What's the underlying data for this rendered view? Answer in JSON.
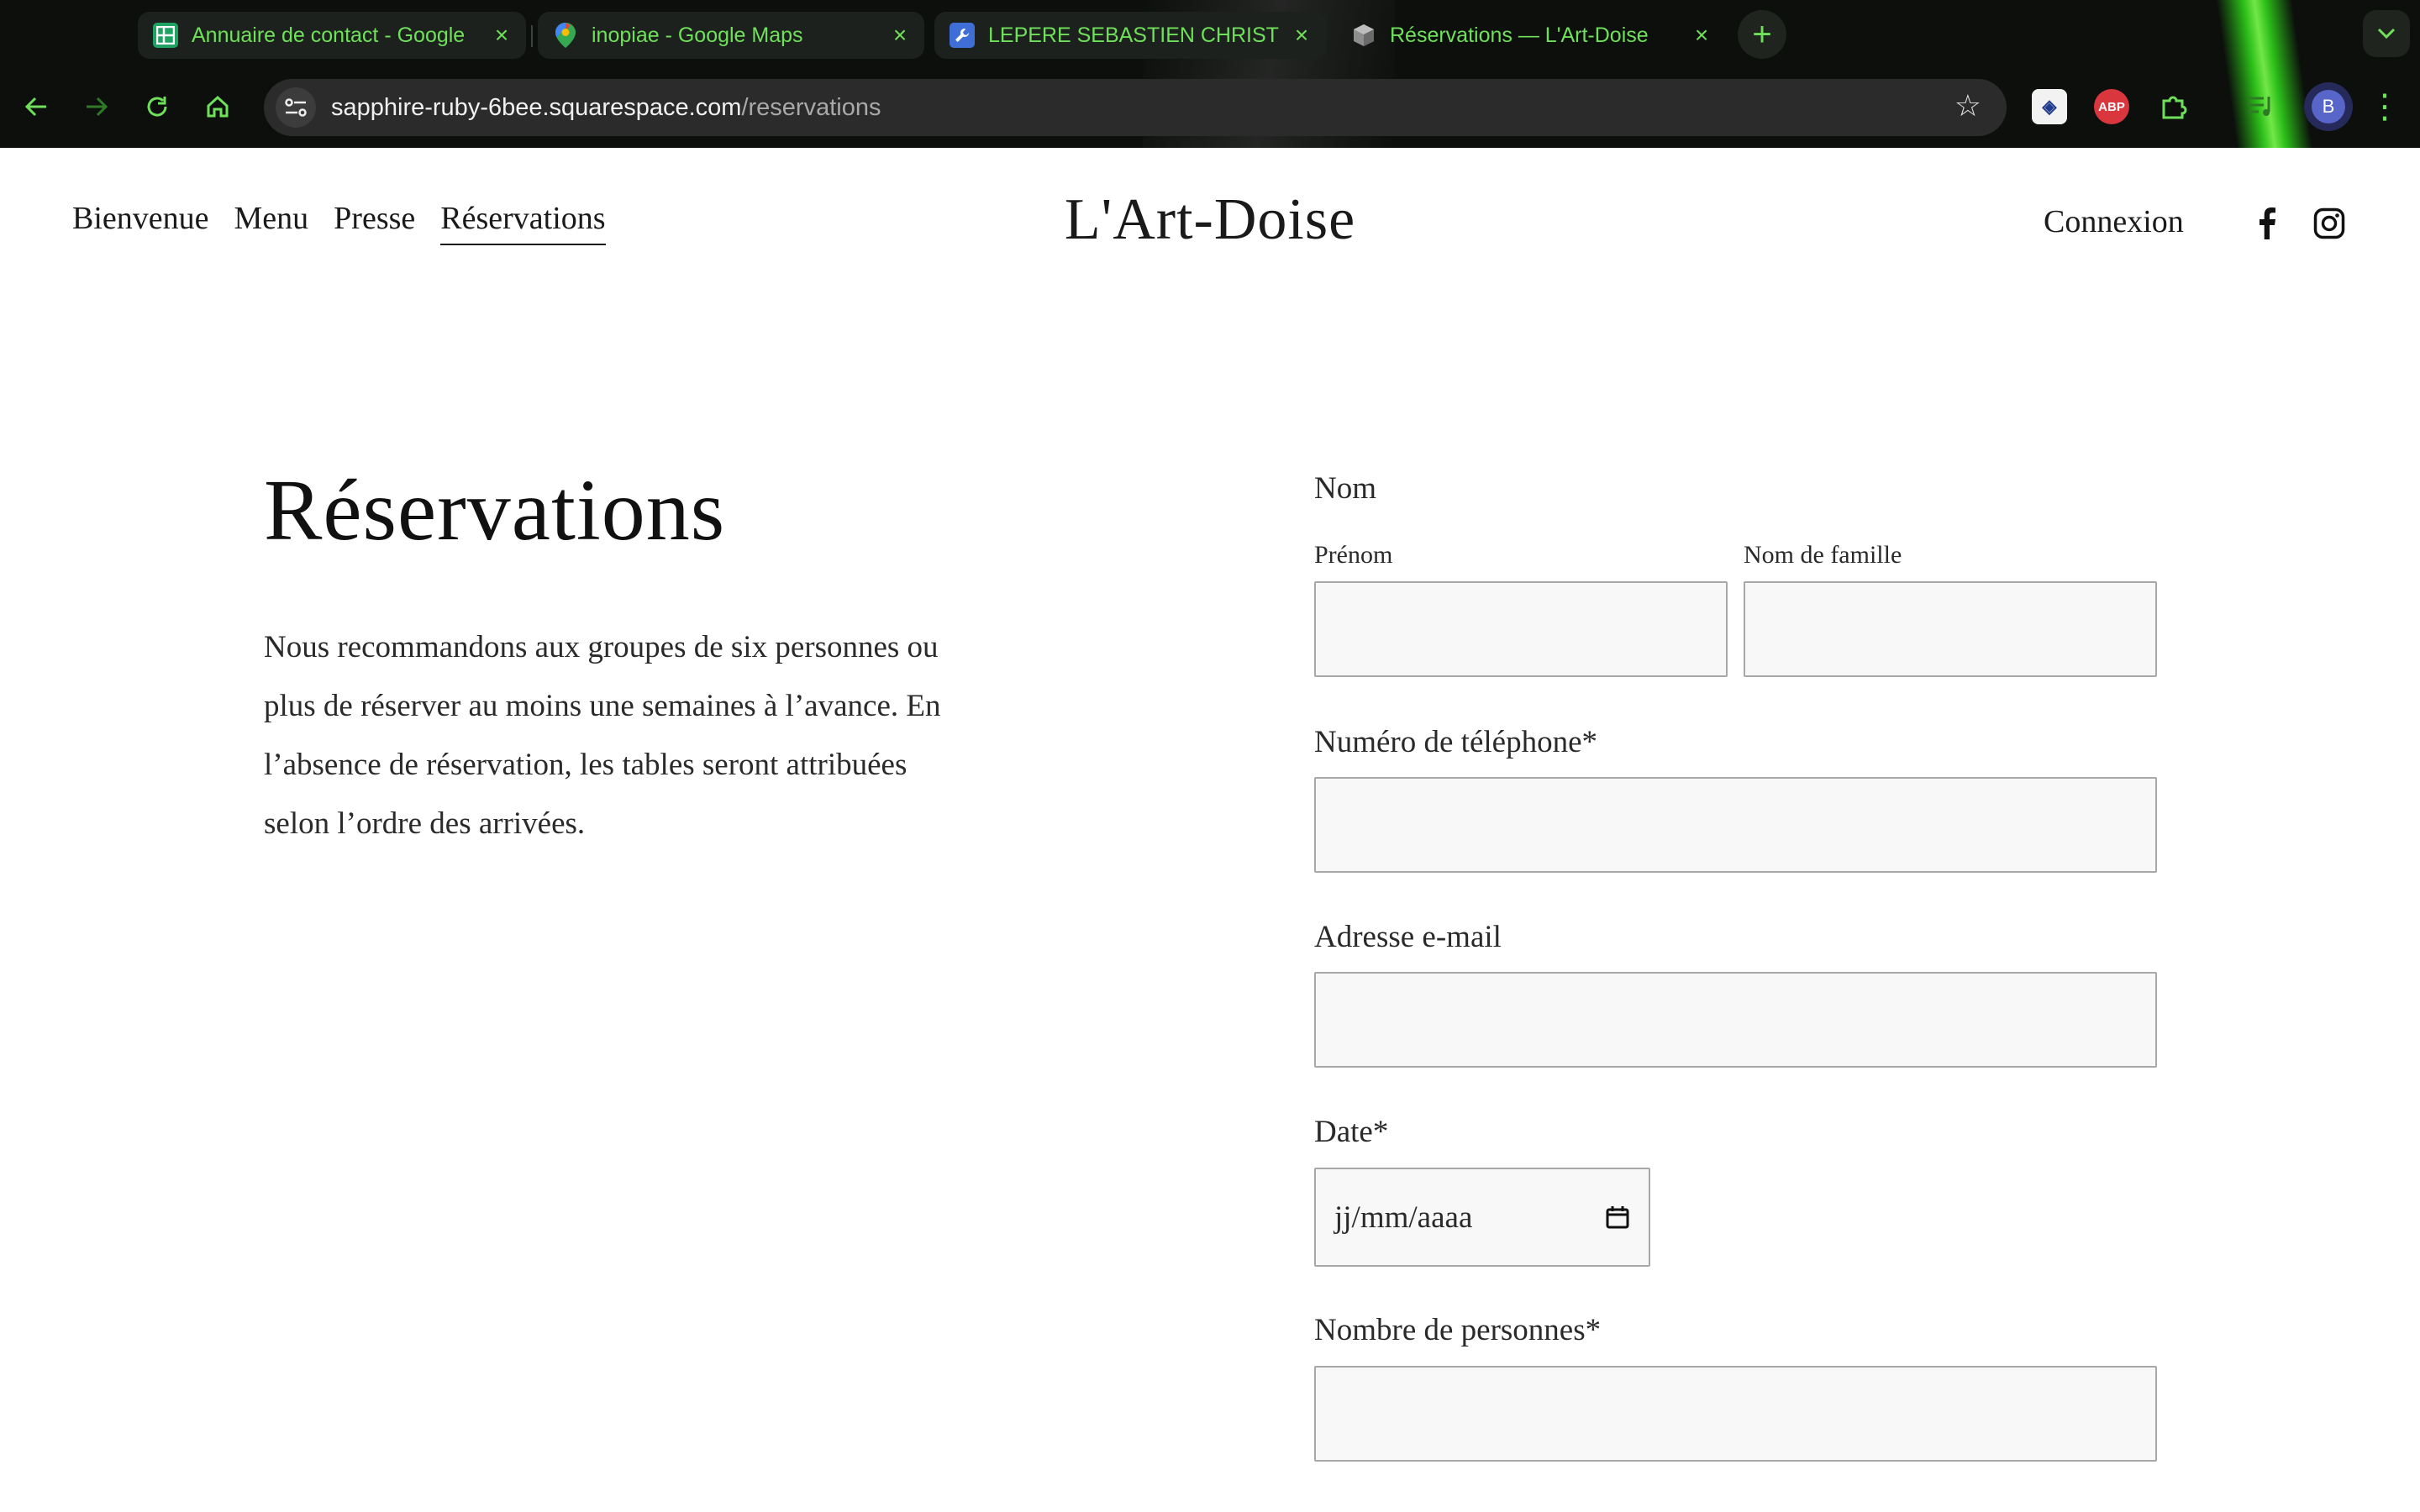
{
  "browser": {
    "tabs": [
      {
        "title": "Annuaire de contact - Google",
        "icon": "sheets-icon",
        "active": false
      },
      {
        "title": "inopiae - Google Maps",
        "icon": "maps-pin-icon",
        "active": false
      },
      {
        "title": "LEPERE SEBASTIEN CHRISTIA",
        "icon": "tool-icon",
        "active": false
      },
      {
        "title": "Réservations — L'Art-Doise",
        "icon": "squarespace-cube-icon",
        "active": true
      }
    ],
    "new_tab_label": "+",
    "url_host": "sapphire-ruby-6bee.squarespace.com",
    "url_path": "/reservations",
    "profile_initial": "B",
    "extensions": {
      "abp_label": "ABP"
    },
    "accent_color": "#6fe05a"
  },
  "site": {
    "nav": [
      {
        "label": "Bienvenue",
        "current": false
      },
      {
        "label": "Menu",
        "current": false
      },
      {
        "label": "Presse",
        "current": false
      },
      {
        "label": "Réservations",
        "current": true
      }
    ],
    "logo": "L'Art-Doise",
    "login_label": "Connexion",
    "social_icons": [
      "facebook-icon",
      "instagram-icon"
    ]
  },
  "page": {
    "title": "Réservations",
    "intro": "Nous recommandons aux groupes de six personnes ou plus de réserver au moins une semaines à l’avance. En l’absence de réservation, les tables seront attribuées selon l’ordre des arrivées."
  },
  "form": {
    "name_label": "Nom",
    "first_name_label": "Prénom",
    "first_name_value": "",
    "last_name_label": "Nom de famille",
    "last_name_value": "",
    "phone_label": "Numéro de téléphone*",
    "phone_value": "",
    "email_label": "Adresse e-mail",
    "email_value": "",
    "date_label": "Date*",
    "date_placeholder": "jj/mm/aaaa",
    "guests_label": "Nombre de personnes*",
    "guests_value": ""
  }
}
